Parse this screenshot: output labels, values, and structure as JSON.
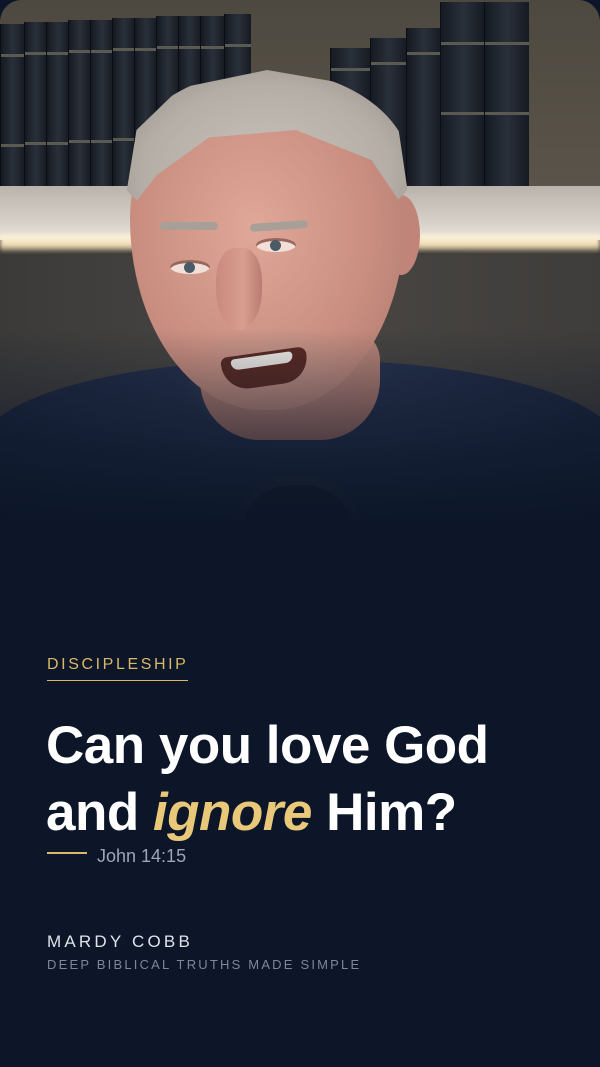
{
  "photo": {
    "subject": "speaker-portrait"
  },
  "content": {
    "category": "DISCIPLESHIP",
    "headline_line1": "Can you love God",
    "headline_pre": "and ",
    "headline_emphasis": "ignore",
    "headline_post": " Him?",
    "reference": "John 14:15"
  },
  "footer": {
    "author": "MARDY COBB",
    "tagline": "DEEP BIBLICAL TRUTHS MADE SIMPLE"
  },
  "colors": {
    "background": "#0c1628",
    "accent_gold": "#d9b86a",
    "headline": "#ffffff",
    "emphasis": "#e9c87a",
    "muted": "#9ba6b7"
  }
}
